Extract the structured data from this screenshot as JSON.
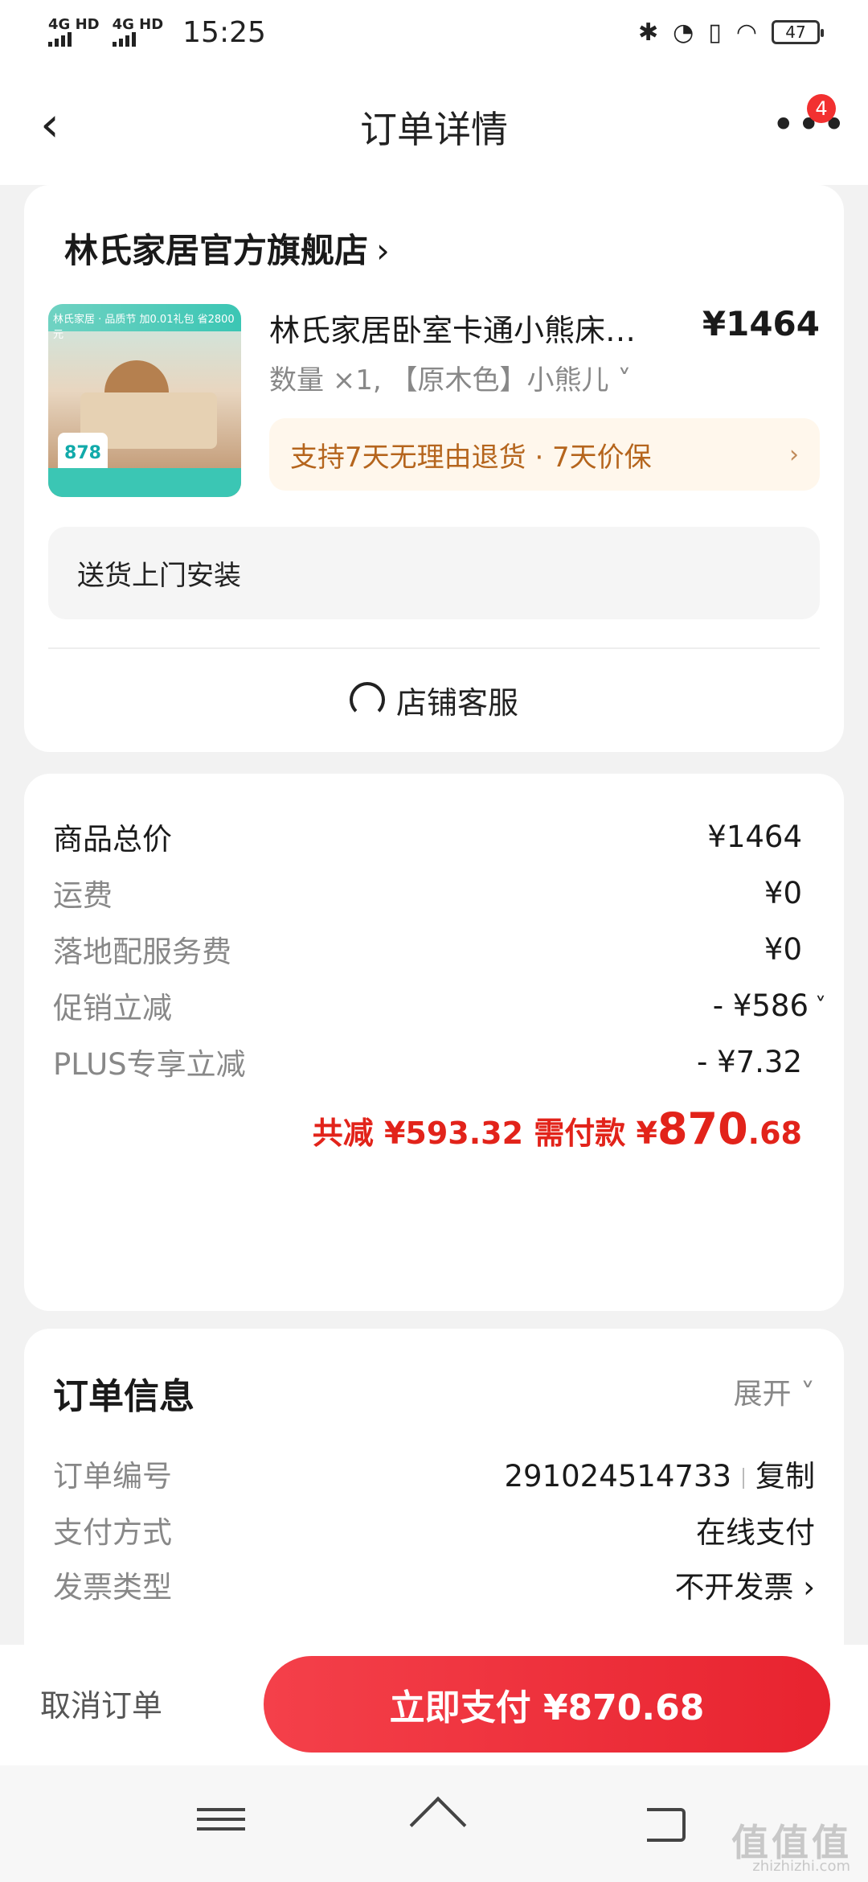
{
  "status_bar": {
    "signal1": "4G HD",
    "signal2": "4G HD",
    "time": "15:25",
    "battery": "47"
  },
  "header": {
    "title": "订单详情",
    "back_icon": "chevron-left-icon",
    "more_icon": "more-dots-icon",
    "badge_count": "4"
  },
  "shop": {
    "name": "林氏家居官方旗舰店",
    "chevron": "›",
    "product": {
      "name": "林氏家居卧室卡通小熊床…",
      "price": "¥1464",
      "spec": "数量 ×1, 【原木色】小熊儿 ˅",
      "thumb_banner": "林氏家居 · 品质节  加0.01礼包  省2800元",
      "thumb_price": "878"
    },
    "service_banner": "支持7天无理由退货 · 7天价保",
    "service_chevron": "›",
    "delivery_note": "送货上门安装",
    "customer_service": "店铺客服"
  },
  "price_detail": {
    "rows": [
      {
        "label": "商品总价",
        "value": "¥1464"
      },
      {
        "label": "运费",
        "value": "¥0"
      },
      {
        "label": "落地配服务费",
        "value": "¥0"
      },
      {
        "label": "促销立减",
        "value": "- ¥586"
      },
      {
        "label": "PLUS专享立减",
        "value": "- ¥7.32"
      }
    ],
    "total_prefix": "共减 ¥593.32  需付款 ¥",
    "total_int": "870",
    "total_dec": ".68",
    "accent_color": "#e2231a"
  },
  "order_info": {
    "title": "订单信息",
    "toggle": "展开 ˅",
    "rows": [
      {
        "label": "订单编号",
        "value": "291024514733",
        "action": "复制"
      },
      {
        "label": "支付方式",
        "value": "在线支付"
      },
      {
        "label": "发票类型",
        "value": "不开发票 ›"
      }
    ]
  },
  "bottom_bar": {
    "cancel": "取消订单",
    "pay": "立即支付  ¥870.68",
    "pay_color": "#e8232f"
  },
  "system_nav": {
    "menu_icon": "menu-icon",
    "home_icon": "home-icon",
    "back_icon": "back-icon"
  },
  "watermark": {
    "text": "值值值",
    "sub": "zhizhizhi.com"
  }
}
